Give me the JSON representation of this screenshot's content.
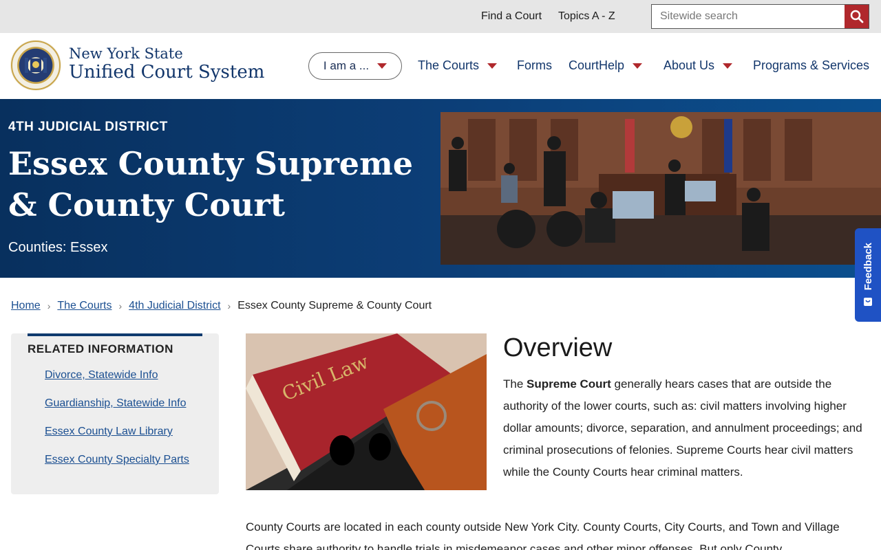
{
  "utility": {
    "find_court": "Find a Court",
    "topics": "Topics A - Z",
    "search_placeholder": "Sitewide search"
  },
  "brand": {
    "line1": "New York State",
    "line2": "Unified Court System",
    "seal_text": "NEW YORK STATE UNIFIED COURT SYSTEM"
  },
  "nav": {
    "iam": "I am a ...",
    "items": [
      "The Courts",
      "Forms",
      "CourtHelp",
      "About Us",
      "Programs & Services"
    ]
  },
  "hero": {
    "eyebrow": "4TH JUDICIAL DISTRICT",
    "title": "Essex County Supreme & County Court",
    "counties": "Counties: Essex"
  },
  "feedback": {
    "label": "Feedback"
  },
  "breadcrumb": [
    "Home",
    "The Courts",
    "4th Judicial District",
    "Essex County Supreme & County Court"
  ],
  "sidebar": {
    "heading": "RELATED INFORMATION",
    "links": [
      "Divorce, Statewide Info",
      "Guardianship, Statewide Info",
      "Essex County Law Library",
      "Essex County Specialty Parts"
    ]
  },
  "main": {
    "image_text": "Civil Law",
    "overview_title": "Overview",
    "para1_prefix": "The ",
    "para1_bold": "Supreme Court",
    "para1_rest": " generally hears cases that are outside the authority of the lower courts, such as: civil matters involving higher dollar amounts; divorce, separation, and annulment proceedings; and criminal prosecutions of felonies. Supreme Courts hear civil matters while the County Courts hear criminal matters.",
    "para2": "County Courts are located in each county outside New York City. County Courts, City Courts, and Town and Village Courts share authority to handle trials in misdemeanor cases and other minor offenses. But only County"
  },
  "colors": {
    "navy": "#12366b",
    "accent_red": "#b0282c",
    "hero_bg": "#0c3e77",
    "feedback_blue": "#1f52c4"
  }
}
